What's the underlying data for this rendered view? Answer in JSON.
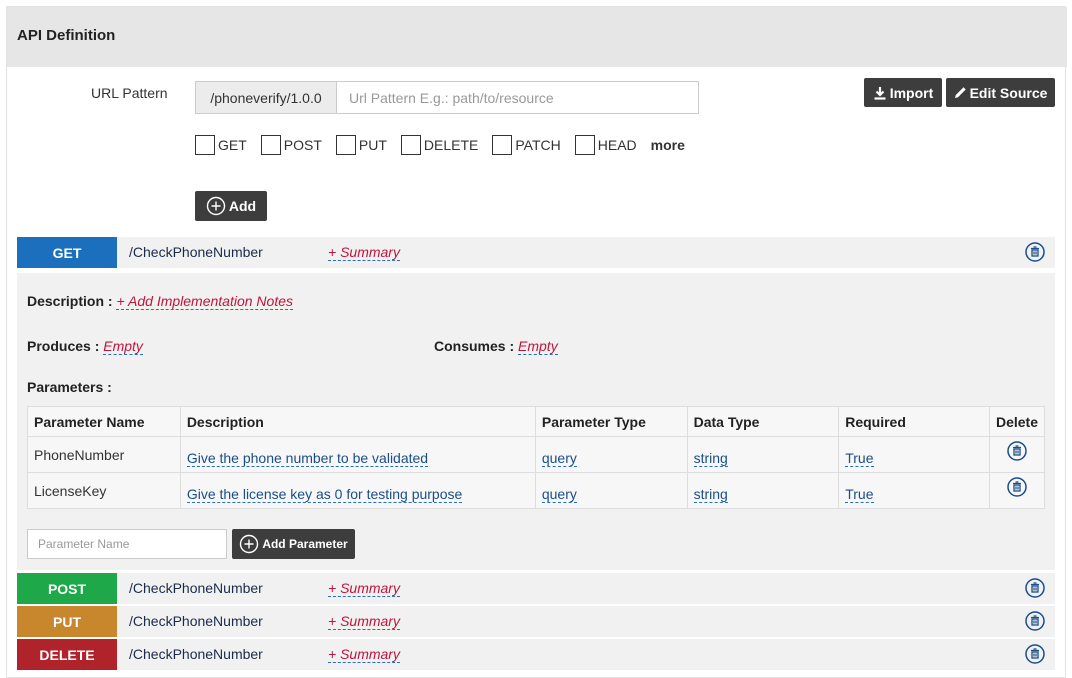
{
  "panel": {
    "title": "API Definition"
  },
  "url": {
    "label": "URL Pattern",
    "prefix": "/phoneverify/1.0.0",
    "placeholder": "Url Pattern E.g.: path/to/resource"
  },
  "toolbar": {
    "import_label": "Import",
    "edit_source_label": "Edit Source"
  },
  "methods": [
    "GET",
    "POST",
    "PUT",
    "DELETE",
    "PATCH",
    "HEAD"
  ],
  "more_label": "more",
  "add_label": "Add",
  "resources": [
    {
      "verb": "GET",
      "color": "#1b6fbc",
      "path": "/CheckPhoneNumber",
      "summary": "+ Summary"
    },
    {
      "verb": "POST",
      "color": "#1ea84a",
      "path": "/CheckPhoneNumber",
      "summary": "+ Summary"
    },
    {
      "verb": "PUT",
      "color": "#c8862d",
      "path": "/CheckPhoneNumber",
      "summary": "+ Summary"
    },
    {
      "verb": "DELETE",
      "color": "#b1232b",
      "path": "/CheckPhoneNumber",
      "summary": "+ Summary"
    }
  ],
  "detail": {
    "description_label": "Description :",
    "description_value": "+ Add Implementation Notes",
    "produces_label": "Produces :",
    "produces_value": "Empty",
    "consumes_label": "Consumes :",
    "consumes_value": "Empty",
    "parameters_label": "Parameters :"
  },
  "params_table": {
    "headers": [
      "Parameter Name",
      "Description",
      "Parameter Type",
      "Data Type",
      "Required",
      "Delete"
    ],
    "rows": [
      {
        "name": "PhoneNumber",
        "description": "Give the phone number to be validated",
        "type": "query",
        "data_type": "string",
        "required": "True"
      },
      {
        "name": "LicenseKey",
        "description": "Give the license key as 0 for testing purpose",
        "type": "query",
        "data_type": "string",
        "required": "True"
      }
    ]
  },
  "add_param": {
    "placeholder": "Parameter Name",
    "button_label": "Add Parameter"
  },
  "icons": {
    "trash_color": "#1a4e8a"
  }
}
